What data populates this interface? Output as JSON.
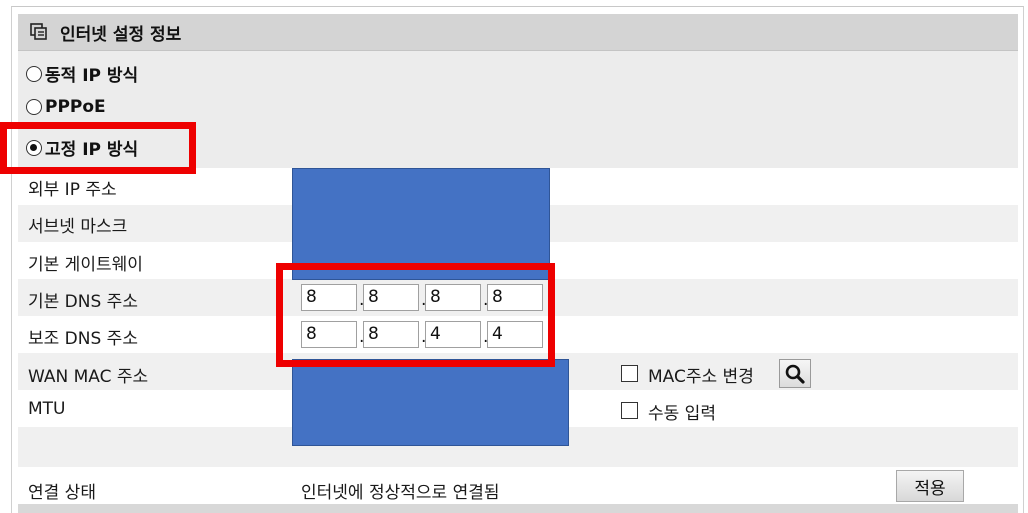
{
  "header": {
    "title": "인터넷 설정 정보",
    "icon": "window-icon"
  },
  "connection_types": [
    {
      "label": "동적 IP 방식",
      "selected": false
    },
    {
      "label": "PPPoE",
      "selected": false
    },
    {
      "label": "고정 IP 방식",
      "selected": true
    }
  ],
  "fields": {
    "external_ip_label": "외부 IP 주소",
    "subnet_label": "서브넷 마스크",
    "gateway_label": "기본 게이트웨이",
    "primary_dns_label": "기본 DNS 주소",
    "secondary_dns_label": "보조 DNS 주소",
    "wan_mac_label": "WAN MAC 주소",
    "mtu_label": "MTU"
  },
  "primary_dns": [
    "8",
    "8",
    "8",
    "8"
  ],
  "secondary_dns": [
    "8",
    "8",
    "4",
    "4"
  ],
  "dns_separator": ".",
  "options": {
    "mac_change_label": "MAC주소 변경",
    "manual_input_label": "수동 입력"
  },
  "status": {
    "label": "연결 상태",
    "value": "인터넷에 정상적으로 연결됨"
  },
  "apply_button": "적용",
  "colors": {
    "highlight": "#ee0000",
    "redaction": "#4472c4"
  }
}
